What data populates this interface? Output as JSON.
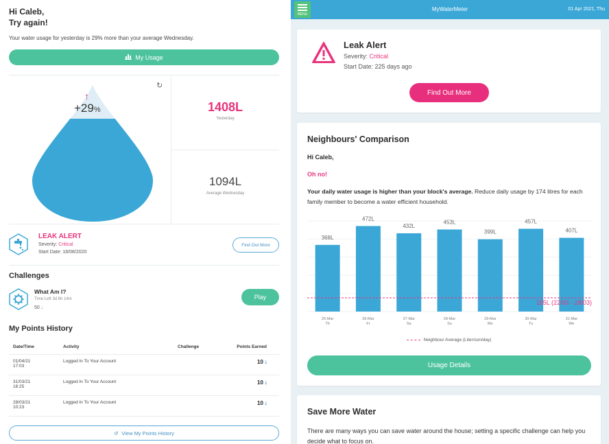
{
  "left": {
    "greeting_line1": "Hi Caleb,",
    "greeting_line2": "Try again!",
    "usage_message": "Your water usage for yesterday is 29% more than your average Wednesday.",
    "my_usage_button": "My Usage",
    "drop_fill_percent": 75,
    "percent_change": "+29",
    "percent_sign": "%",
    "yesterday_value": "1408L",
    "yesterday_label": "Yesterday",
    "average_value": "1094L",
    "average_label": "Average Wednesday",
    "leak": {
      "title": "LEAK ALERT",
      "severity_label": "Severity: ",
      "severity_value": "Critical",
      "start_date": "Start Date: 18/08/2020",
      "button": "Find Out More"
    },
    "challenges_heading": "Challenges",
    "challenge": {
      "name": "What Am I?",
      "time_left": "Time Left 3d 6h 14m",
      "points": "50",
      "button": "Play"
    },
    "points_heading": "My Points History",
    "points_table": {
      "headers": [
        "Date/Time",
        "Activity",
        "Challenge",
        "Points Earned"
      ],
      "rows": [
        {
          "date": "01/04/21",
          "time": "17:03",
          "activity": "Logged In To Your Account",
          "challenge": "",
          "points": "10"
        },
        {
          "date": "31/03/21",
          "time": "16:25",
          "activity": "Logged In To Your Account",
          "challenge": "",
          "points": "10"
        },
        {
          "date": "28/03/21",
          "time": "10:23",
          "activity": "Logged In To Your Account",
          "challenge": "",
          "points": "10"
        }
      ]
    },
    "view_history_button": "View My Points History"
  },
  "right": {
    "menu_label": "MENU",
    "app_title": "MyWaterMeter",
    "date": "01 Apr 2021, Thu",
    "leak": {
      "title": "Leak Alert",
      "severity_label": "Severity: ",
      "severity_value": "Critical",
      "start_date": "Start Date: 225 days ago",
      "button": "Find Out More"
    },
    "neighbours": {
      "title": "Neighbours' Comparison",
      "hi": "Hi Caleb,",
      "oh_no": "Oh no!",
      "message_bold": "Your daily water usage is higher than your block's average.",
      "message_rest": " Reduce daily usage by 174 litres for each family member to become a water efficient household.",
      "legend": "Neighbour Average (Liter/son/day)",
      "usage_details_button": "Usage Details"
    },
    "save": {
      "title": "Save More Water",
      "text": "There are many ways you can save water around the house; setting a specific challenge can help you decide what to focus on."
    }
  },
  "chart_data": {
    "type": "bar",
    "categories": [
      "25-Mar Th",
      "26-Mar Fr",
      "27-Mar Sa",
      "28-Mar Su",
      "29-Mar Mo",
      "30-Mar Tu",
      "31-Mar We"
    ],
    "category_dates": [
      "25-Mar",
      "26-Mar",
      "27-Mar",
      "28-Mar",
      "29-Mar",
      "30-Mar",
      "31-Mar"
    ],
    "category_days": [
      "Th",
      "Fr",
      "Sa",
      "Su",
      "Mo",
      "Tu",
      "We"
    ],
    "values": [
      368,
      472,
      432,
      453,
      399,
      457,
      407
    ],
    "value_labels": [
      "368L",
      "472L",
      "432L",
      "453L",
      "399L",
      "457L",
      "407L"
    ],
    "reference_line": {
      "value": 155,
      "label": "155L (22/03 - 28/03)"
    },
    "ylim": [
      0,
      500
    ],
    "bar_color": "#3aa7d7",
    "reference_color": "#e8347d",
    "grid": true
  },
  "colors": {
    "accent_green": "#4cc39d",
    "accent_pink": "#e8347d",
    "accent_blue": "#3aa7d7"
  }
}
